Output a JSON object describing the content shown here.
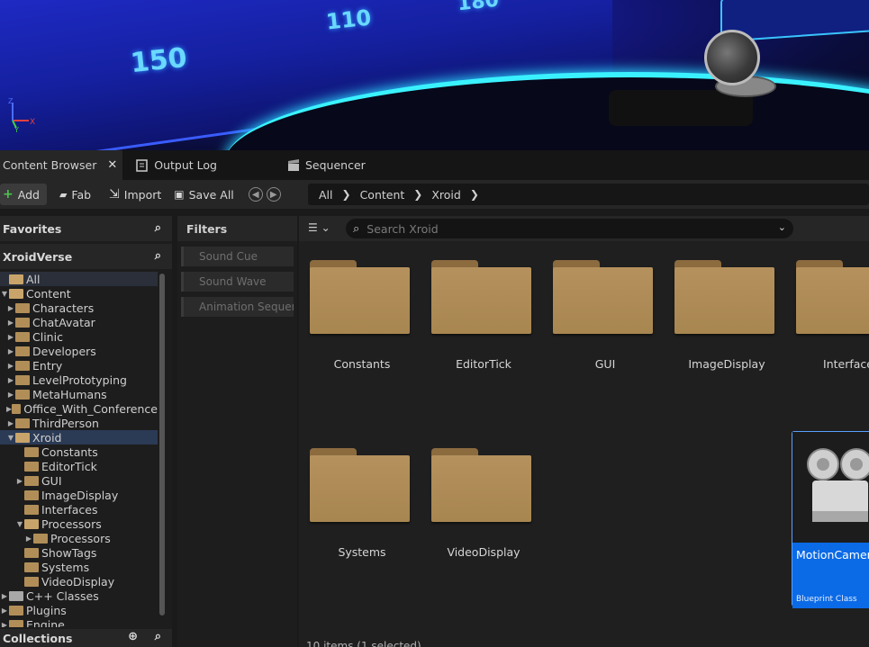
{
  "viewport": {
    "numbers": [
      "150",
      "110",
      "180"
    ],
    "axis_labels": {
      "x": "X",
      "y": "Y",
      "z": "Z"
    }
  },
  "tabs": [
    {
      "label": "Content Browser",
      "active": true
    },
    {
      "label": "Output Log",
      "active": false
    },
    {
      "label": "Sequencer",
      "active": false
    }
  ],
  "toolbar": {
    "add_label": "Add",
    "fab_label": "Fab",
    "import_label": "Import",
    "save_all_label": "Save All",
    "breadcrumb": [
      "All",
      "Content",
      "Xroid"
    ]
  },
  "sidebar": {
    "favorites_label": "Favorites",
    "project_label": "XroidVerse",
    "collections_label": "Collections",
    "tree": [
      {
        "label": "All",
        "depth": 0,
        "arrow": "",
        "folder": "open"
      },
      {
        "label": "Content",
        "depth": 0,
        "arrow": "▼",
        "folder": "open"
      },
      {
        "label": "Characters",
        "depth": 1,
        "arrow": "▶",
        "folder": "closed"
      },
      {
        "label": "ChatAvatar",
        "depth": 1,
        "arrow": "▶",
        "folder": "closed"
      },
      {
        "label": "Clinic",
        "depth": 1,
        "arrow": "▶",
        "folder": "closed"
      },
      {
        "label": "Developers",
        "depth": 1,
        "arrow": "▶",
        "folder": "closed"
      },
      {
        "label": "Entry",
        "depth": 1,
        "arrow": "▶",
        "folder": "closed"
      },
      {
        "label": "LevelPrototyping",
        "depth": 1,
        "arrow": "▶",
        "folder": "closed"
      },
      {
        "label": "MetaHumans",
        "depth": 1,
        "arrow": "▶",
        "folder": "closed"
      },
      {
        "label": "Office_With_Conference",
        "depth": 1,
        "arrow": "▶",
        "folder": "closed"
      },
      {
        "label": "ThirdPerson",
        "depth": 1,
        "arrow": "▶",
        "folder": "closed"
      },
      {
        "label": "Xroid",
        "depth": 1,
        "arrow": "▼",
        "folder": "open",
        "selected": true
      },
      {
        "label": "Constants",
        "depth": 2,
        "arrow": "",
        "folder": "closed"
      },
      {
        "label": "EditorTick",
        "depth": 2,
        "arrow": "",
        "folder": "closed"
      },
      {
        "label": "GUI",
        "depth": 2,
        "arrow": "▶",
        "folder": "closed"
      },
      {
        "label": "ImageDisplay",
        "depth": 2,
        "arrow": "",
        "folder": "closed"
      },
      {
        "label": "Interfaces",
        "depth": 2,
        "arrow": "",
        "folder": "closed"
      },
      {
        "label": "Processors",
        "depth": 2,
        "arrow": "▼",
        "folder": "open"
      },
      {
        "label": "Processors",
        "depth": 3,
        "arrow": "▶",
        "folder": "closed"
      },
      {
        "label": "ShowTags",
        "depth": 2,
        "arrow": "",
        "folder": "closed"
      },
      {
        "label": "Systems",
        "depth": 2,
        "arrow": "",
        "folder": "closed"
      },
      {
        "label": "VideoDisplay",
        "depth": 2,
        "arrow": "",
        "folder": "closed"
      },
      {
        "label": "C++ Classes",
        "depth": 0,
        "arrow": "▶",
        "folder": "class"
      },
      {
        "label": "Plugins",
        "depth": 0,
        "arrow": "▶",
        "folder": "closed"
      },
      {
        "label": "Engine",
        "depth": 0,
        "arrow": "▶",
        "folder": "closed"
      }
    ]
  },
  "filters": {
    "title": "Filters",
    "chips": [
      "Sound Cue",
      "Sound Wave",
      "Animation Sequen"
    ]
  },
  "search": {
    "placeholder": "Search Xroid"
  },
  "assets": [
    {
      "name": "Constants",
      "kind": "folder"
    },
    {
      "name": "EditorTick",
      "kind": "folder"
    },
    {
      "name": "GUI",
      "kind": "folder"
    },
    {
      "name": "ImageDisplay",
      "kind": "folder"
    },
    {
      "name": "Interface",
      "kind": "folder"
    },
    {
      "name": "Systems",
      "kind": "folder"
    },
    {
      "name": "VideoDisplay",
      "kind": "folder"
    },
    {
      "name": "MotionCamera",
      "kind": "blueprint",
      "type_label": "Blueprint Class",
      "selected": true
    }
  ],
  "status": "10 items (1 selected)",
  "colors": {
    "accent": "#0b6ae6",
    "folder": "#b5915d",
    "selection": "#2b3a55"
  }
}
